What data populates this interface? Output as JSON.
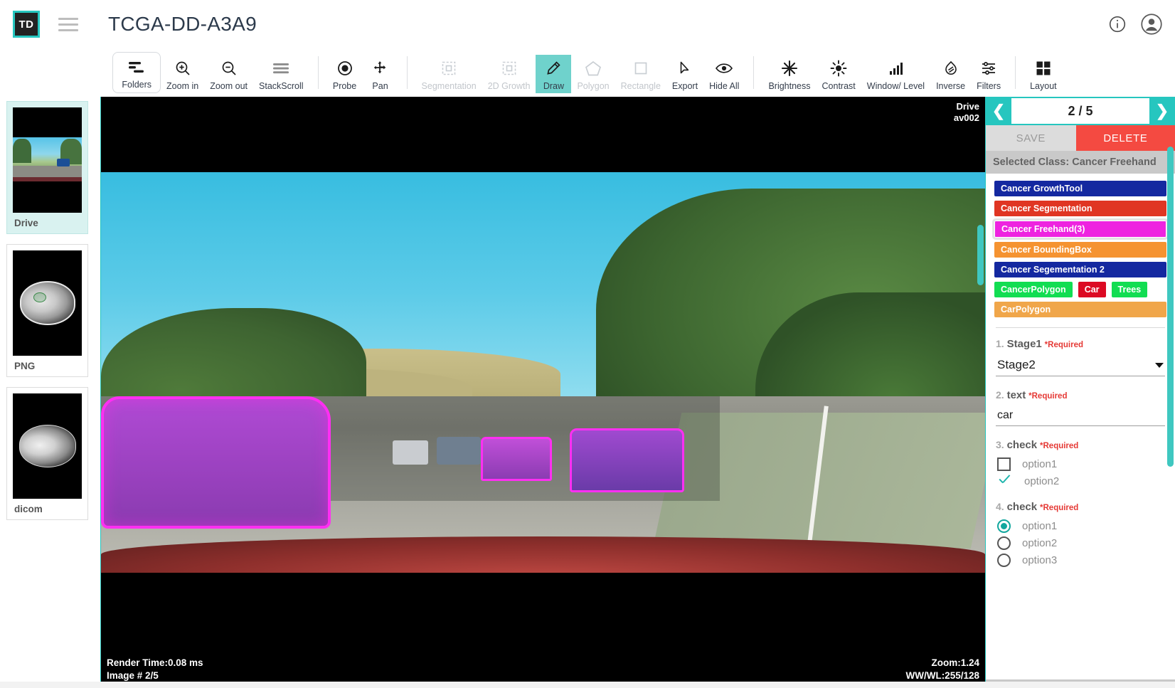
{
  "header": {
    "logo_text": "TD",
    "menu_icon": "hamburger-icon",
    "title": "TCGA-DD-A3A9",
    "info_icon": "info-icon",
    "account_icon": "account-circle-icon"
  },
  "toolbar": {
    "items": [
      {
        "label": "Folders",
        "icon": "folders-icon",
        "state": "boxed"
      },
      {
        "label": "Zoom in",
        "icon": "zoom-in-icon",
        "state": "normal"
      },
      {
        "label": "Zoom out",
        "icon": "zoom-out-icon",
        "state": "normal"
      },
      {
        "label": "StackScroll",
        "icon": "stack-scroll-icon",
        "state": "normal"
      },
      {
        "label": "Probe",
        "icon": "probe-icon",
        "state": "normal"
      },
      {
        "label": "Pan",
        "icon": "pan-icon",
        "state": "normal"
      },
      {
        "label": "Segmentation",
        "icon": "segmentation-icon",
        "state": "disabled"
      },
      {
        "label": "2D Growth",
        "icon": "growth-icon",
        "state": "disabled"
      },
      {
        "label": "Draw",
        "icon": "pencil-icon",
        "state": "active"
      },
      {
        "label": "Polygon",
        "icon": "polygon-icon",
        "state": "disabled"
      },
      {
        "label": "Rectangle",
        "icon": "rectangle-icon",
        "state": "disabled"
      },
      {
        "label": "Export",
        "icon": "cursor-icon",
        "state": "normal"
      },
      {
        "label": "Hide All",
        "icon": "eye-icon",
        "state": "normal"
      },
      {
        "label": "Brightness",
        "icon": "brightness-icon",
        "state": "normal"
      },
      {
        "label": "Contrast",
        "icon": "contrast-icon",
        "state": "normal"
      },
      {
        "label": "Window/ Level",
        "icon": "window-level-icon",
        "state": "normal"
      },
      {
        "label": "Inverse",
        "icon": "inverse-icon",
        "state": "normal"
      },
      {
        "label": "Filters",
        "icon": "filters-icon",
        "state": "normal"
      },
      {
        "label": "Layout",
        "icon": "layout-grid-icon",
        "state": "normal"
      }
    ]
  },
  "thumbnails": [
    {
      "caption": "Drive",
      "selected": true
    },
    {
      "caption": "PNG",
      "selected": false
    },
    {
      "caption": "dicom",
      "selected": false
    }
  ],
  "viewport": {
    "label_line1": "Drive",
    "label_line2": "av002",
    "render_time": "Render Time:0.08 ms",
    "image_number": "Image # 2/5",
    "zoom": "Zoom:1.24",
    "ww_wl": "WW/WL:255/128"
  },
  "panel": {
    "prev_icon": "chevron-left-icon",
    "next_icon": "chevron-right-icon",
    "page_indicator": "2 / 5",
    "save_label": "SAVE",
    "delete_label": "DELETE",
    "selected_class_text": "Selected Class: Cancer Freehand",
    "classes": [
      {
        "label": "Cancer GrowthTool",
        "color": "#1428a0",
        "selected": false,
        "full_row": true
      },
      {
        "label": "Cancer Segmentation",
        "color": "#e03523",
        "selected": false,
        "full_row": true
      },
      {
        "label": "Cancer Freehand(3)",
        "color": "#ee23e0",
        "selected": true,
        "full_row": true
      },
      {
        "label": "Cancer BoundingBox",
        "color": "#f59331",
        "selected": false,
        "full_row": true
      },
      {
        "label": "Cancer Segementation 2",
        "color": "#1428a0",
        "selected": false,
        "full_row": true
      },
      {
        "label": "CancerPolygon",
        "color": "#12dd52",
        "selected": false,
        "full_row": false
      },
      {
        "label": "Car",
        "color": "#dc0a23",
        "selected": false,
        "full_row": false
      },
      {
        "label": "Trees",
        "color": "#12dd52",
        "selected": false,
        "full_row": false
      },
      {
        "label": "CarPolygon",
        "color": "#f0a64a",
        "selected": false,
        "full_row": true
      }
    ],
    "form": [
      {
        "number": "1.",
        "name": "Stage1",
        "required": "*Required",
        "type": "select",
        "value": "Stage2"
      },
      {
        "number": "2.",
        "name": "text",
        "required": "*Required",
        "type": "text",
        "value": "car"
      },
      {
        "number": "3.",
        "name": "check",
        "required": "*Required",
        "type": "checkbox",
        "options": [
          {
            "label": "option1",
            "checked": false
          },
          {
            "label": "option2",
            "checked": true
          }
        ]
      },
      {
        "number": "4.",
        "name": "check",
        "required": "*Required",
        "type": "radio",
        "options": [
          {
            "label": "option1",
            "checked": true
          },
          {
            "label": "option2",
            "checked": false
          },
          {
            "label": "option3",
            "checked": false
          }
        ]
      }
    ]
  },
  "colors": {
    "accent": "#26c6bf",
    "delete": "#f44a41",
    "annotation": "#ff2ff2"
  }
}
